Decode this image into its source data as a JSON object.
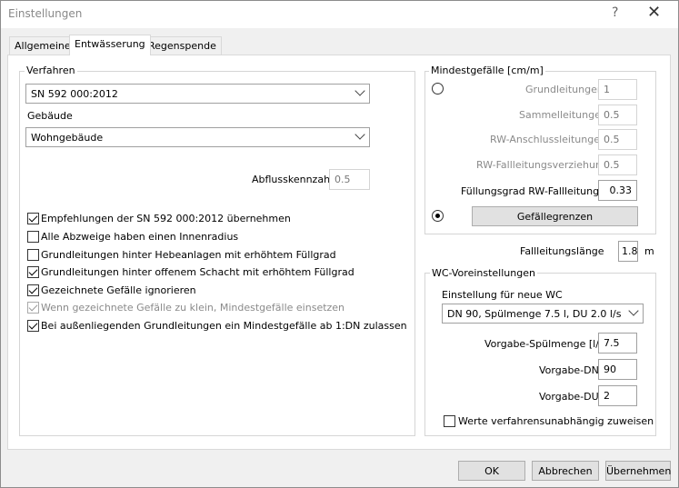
{
  "window": {
    "title": "Einstellungen",
    "help": "?",
    "close": "✕"
  },
  "tabs": [
    "Allgemeines",
    "Entwässerung",
    "Regenspende"
  ],
  "left": {
    "group_title": "Verfahren",
    "verfahren_value": "SN 592 000:2012",
    "gebaeude_label": "Gebäude",
    "gebaeude_value": "Wohngebäude",
    "abfluss_label": "Abflusskennzahl",
    "abfluss_value": "0.5",
    "checks": [
      {
        "label": "Empfehlungen der SN 592 000:2012 übernehmen",
        "checked": true,
        "disabled": false
      },
      {
        "label": "Alle Abzweige haben einen Innenradius",
        "checked": false,
        "disabled": false
      },
      {
        "label": "Grundleitungen hinter Hebeanlagen mit erhöhtem Füllgrad",
        "checked": false,
        "disabled": false
      },
      {
        "label": "Grundleitungen hinter offenem Schacht mit erhöhtem Füllgrad",
        "checked": true,
        "disabled": false
      },
      {
        "label": "Gezeichnete Gefälle ignorieren",
        "checked": true,
        "disabled": false
      },
      {
        "label": "Wenn gezeichnete Gefälle zu klein, Mindestgefälle einsetzen",
        "checked": true,
        "disabled": true
      },
      {
        "label": "Bei außenliegenden Grundleitungen ein Mindestgefälle ab 1:DN zulassen",
        "checked": true,
        "disabled": false
      }
    ]
  },
  "mindest": {
    "group_title": "Mindestgefälle [cm/m]",
    "rows": [
      {
        "label": "Grundleitungen",
        "value": "1"
      },
      {
        "label": "Sammelleitungen",
        "value": "0.5"
      },
      {
        "label": "RW-Anschlussleitungen",
        "value": "0.5"
      },
      {
        "label": "RW-Fallleitungsverziehung",
        "value": "0.5"
      }
    ],
    "fuellgrad_label": "Füllungsgrad RW-Fallleitungen",
    "fuellgrad_value": "0.33",
    "gefaelle_button": "Gefällegrenzen"
  },
  "fall": {
    "label": "Fallleitungslänge",
    "value": "1.8",
    "unit": "m"
  },
  "wc": {
    "group_title": "WC-Voreinstellungen",
    "neu_label": "Einstellung für neue WC",
    "neu_value": "DN  90, Spülmenge 7.5 l, DU 2.0 l/s",
    "spuel_label": "Vorgabe-Spülmenge [l/s]",
    "spuel_value": "7.5",
    "dn_label": "Vorgabe-DN",
    "dn_value": "90",
    "du_label": "Vorgabe-DU",
    "du_value": "2",
    "werte_label": "Werte verfahrensunabhängig zuweisen"
  },
  "buttons": {
    "ok": "OK",
    "abbrechen": "Abbrechen",
    "uebernehmen": "Übernehmen"
  }
}
